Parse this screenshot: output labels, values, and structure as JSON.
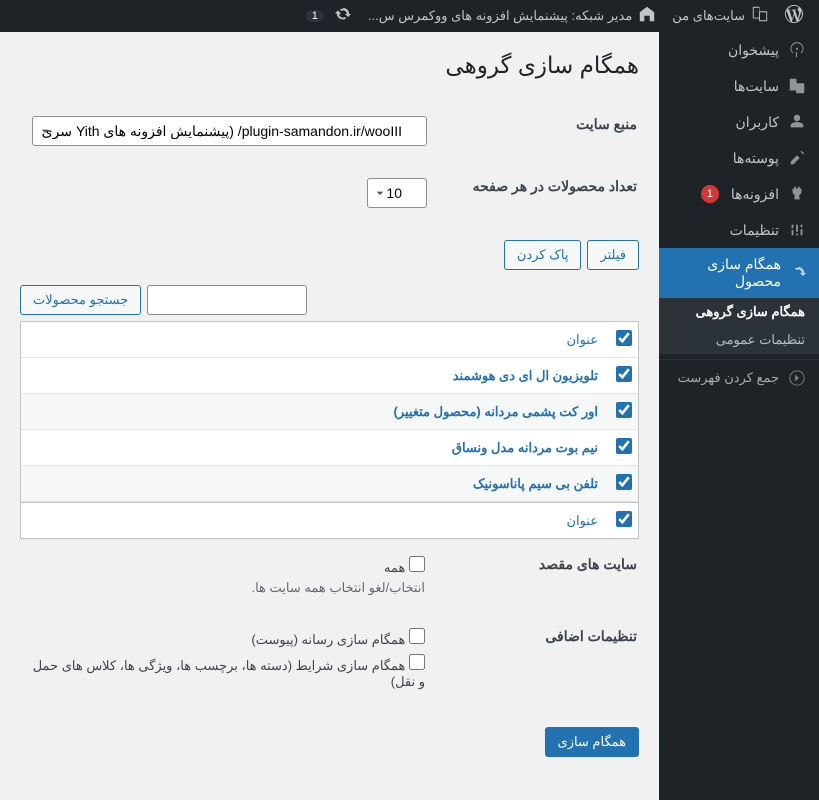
{
  "adminbar": {
    "my_sites": "سایت‌های من",
    "network_admin": "مدیر شبکه: پیشنمایش افزونه های ووکمرس س...",
    "update_count": "1"
  },
  "sidebar": {
    "items": [
      {
        "label": "پیشخوان",
        "icon": "dashboard"
      },
      {
        "label": "سایت‌ها",
        "icon": "sites"
      },
      {
        "label": "کاربران",
        "icon": "users"
      },
      {
        "label": "پوسته‌ها",
        "icon": "themes"
      },
      {
        "label": "افزونه‌ها",
        "icon": "plugins",
        "badge": "1"
      },
      {
        "label": "تنظیمات",
        "icon": "settings"
      },
      {
        "label": "همگام سازی محصول",
        "icon": "sync",
        "current": true
      }
    ],
    "sub_items": [
      {
        "label": "همگام سازی گروهی",
        "current": true
      },
      {
        "label": "تنظیمات عمومی"
      }
    ],
    "collapse": "جمع کردن فهرست"
  },
  "page": {
    "title": "همگام سازی گروهی",
    "source_site_label": "منبع سایت",
    "source_site_value": "plugin-samandon.ir/wooIII/ (پیشنمایش افزونه های Yith سری",
    "per_page_label": "تعداد محصولات در هر صفحه",
    "per_page_value": "10",
    "filter_btn": "فیلتر",
    "clear_btn": "پاک کردن",
    "search_btn": "جستجو محصولات",
    "column_title": "عنوان",
    "products": [
      "تلویزیون ال ای دی هوشمند",
      "اور کت پشمی مردانه (محصول متغییر)",
      "نیم بوت مردانه مدل ونساق",
      "تلفن بی سیم پاناسونیک"
    ],
    "dest_sites_label": "سایت های مقصد",
    "all_label": "همه",
    "dest_hint": "انتخاب/لغو انتخاب همه سایت ها.",
    "extra_label": "تنظیمات اضافی",
    "sync_media": "همگام سازی رسانه (پیوست)",
    "sync_terms": "همگام سازی شرایط (دسته ها، برچسب ها، ویژگی ها، کلاس های حمل و نقل)",
    "submit": "همگام سازی"
  }
}
